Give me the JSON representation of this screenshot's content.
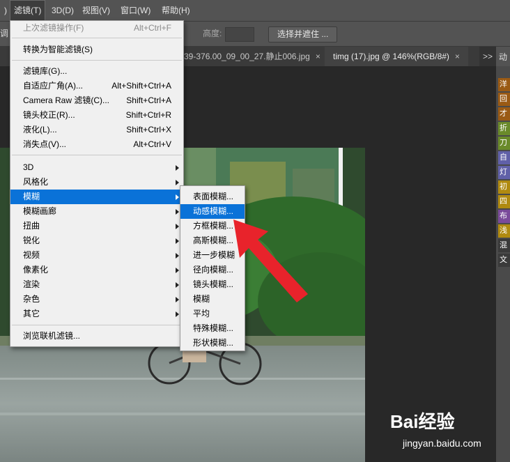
{
  "menubar": {
    "items": [
      {
        "label": ")"
      },
      {
        "label": "滤镜(T)"
      },
      {
        "label": "3D(D)"
      },
      {
        "label": "视图(V)"
      },
      {
        "label": "窗口(W)"
      },
      {
        "label": "帮助(H)"
      }
    ]
  },
  "options": {
    "cut_label": "调",
    "height_label": "高度:",
    "select_mask_label": "选择并遮住 ..."
  },
  "tabs": [
    {
      "label": "39-376.00_09_00_27.静止006.jpg",
      "close": "×"
    },
    {
      "label": "timg (17).jpg @ 146%(RGB/8#)",
      "close": "×"
    }
  ],
  "tab_collapse": ">>",
  "right_panel": {
    "header": "动",
    "swatches": [
      {
        "label": "洋",
        "color": "#9a5a14"
      },
      {
        "label": "回",
        "color": "#9a5a14"
      },
      {
        "label": "才",
        "color": "#9a5a14"
      },
      {
        "label": "折",
        "color": "#6a8a2a"
      },
      {
        "label": "刀",
        "color": "#6a8a2a"
      },
      {
        "label": "自",
        "color": "#6060a8"
      },
      {
        "label": "灯",
        "color": "#6060a8"
      },
      {
        "label": "初",
        "color": "#b08a10"
      },
      {
        "label": "四",
        "color": "#b08a10"
      },
      {
        "label": "布",
        "color": "#7a4a9a"
      },
      {
        "label": "浅",
        "color": "#b08a10"
      },
      {
        "label": "混",
        "color": "#3a3a3a"
      },
      {
        "label": "文",
        "color": "#3a3a3a"
      }
    ]
  },
  "filter_menu": {
    "items": [
      {
        "label": "上次滤镜操作(F)",
        "shortcut": "Alt+Ctrl+F",
        "disabled": true
      },
      {
        "label": "转换为智能滤镜(S)",
        "shortcut": ""
      },
      {
        "label": "滤镜库(G)...",
        "shortcut": ""
      },
      {
        "label": "自适应广角(A)...",
        "shortcut": "Alt+Shift+Ctrl+A"
      },
      {
        "label": "Camera Raw 滤镜(C)...",
        "shortcut": "Shift+Ctrl+A"
      },
      {
        "label": "镜头校正(R)...",
        "shortcut": "Shift+Ctrl+R"
      },
      {
        "label": "液化(L)...",
        "shortcut": "Shift+Ctrl+X"
      },
      {
        "label": "消失点(V)...",
        "shortcut": "Alt+Ctrl+V"
      },
      {
        "label": "3D",
        "shortcut": ""
      },
      {
        "label": "风格化",
        "shortcut": ""
      },
      {
        "label": "模糊",
        "shortcut": ""
      },
      {
        "label": "模糊画廊",
        "shortcut": ""
      },
      {
        "label": "扭曲",
        "shortcut": ""
      },
      {
        "label": "锐化",
        "shortcut": ""
      },
      {
        "label": "视频",
        "shortcut": ""
      },
      {
        "label": "像素化",
        "shortcut": ""
      },
      {
        "label": "渲染",
        "shortcut": ""
      },
      {
        "label": "杂色",
        "shortcut": ""
      },
      {
        "label": "其它",
        "shortcut": ""
      },
      {
        "label": "浏览联机滤镜...",
        "shortcut": ""
      }
    ]
  },
  "blur_submenu": {
    "items": [
      {
        "label": "表面模糊..."
      },
      {
        "label": "动感模糊..."
      },
      {
        "label": "方框模糊..."
      },
      {
        "label": "高斯模糊..."
      },
      {
        "label": "进一步模糊"
      },
      {
        "label": "径向模糊..."
      },
      {
        "label": "镜头模糊..."
      },
      {
        "label": "模糊"
      },
      {
        "label": "平均"
      },
      {
        "label": "特殊模糊..."
      },
      {
        "label": "形状模糊..."
      }
    ]
  },
  "colors": {
    "highlight": "#0a72d8",
    "annotation_arrow": "#e8232b"
  },
  "watermark": {
    "brand": "Bai经验",
    "url": "jingyan.baidu.com"
  }
}
